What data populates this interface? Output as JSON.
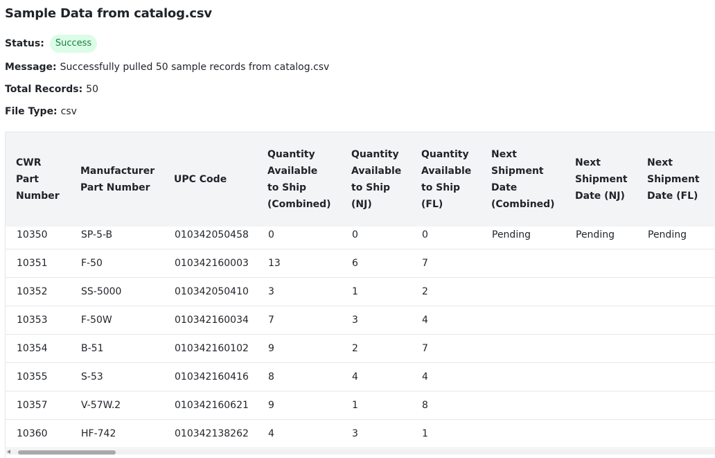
{
  "page": {
    "title": "Sample Data from catalog.csv",
    "status_label": "Status:",
    "status_value": "Success",
    "message_label": "Message:",
    "message_value": "Successfully pulled 50 sample records from catalog.csv",
    "total_label": "Total Records:",
    "total_value": "50",
    "filetype_label": "File Type:",
    "filetype_value": "csv"
  },
  "colors": {
    "badge_bg": "#dcfce7",
    "badge_text": "#15803d",
    "header_bg": "#f3f4f6"
  },
  "table": {
    "headers": [
      [
        "CWR",
        "Part",
        "Number"
      ],
      [
        "Manufacturer",
        "Part Number"
      ],
      [
        "UPC Code"
      ],
      [
        "Quantity",
        "Available",
        "to Ship",
        "(Combined)"
      ],
      [
        "Quantity",
        "Available",
        "to Ship",
        "(NJ)"
      ],
      [
        "Quantity",
        "Available",
        "to Ship",
        "(FL)"
      ],
      [
        "Next",
        "Shipment",
        "Date",
        "(Combined)"
      ],
      [
        "Next",
        "Shipment",
        "Date (NJ)"
      ],
      [
        "Next",
        "Shipment",
        "Date (FL)"
      ]
    ],
    "rows": [
      [
        "10350",
        "SP-5-B",
        "010342050458",
        "0",
        "0",
        "0",
        "Pending",
        "Pending",
        "Pending"
      ],
      [
        "10351",
        "F-50",
        "010342160003",
        "13",
        "6",
        "7",
        "",
        "",
        ""
      ],
      [
        "10352",
        "SS-5000",
        "010342050410",
        "3",
        "1",
        "2",
        "",
        "",
        ""
      ],
      [
        "10353",
        "F-50W",
        "010342160034",
        "7",
        "3",
        "4",
        "",
        "",
        ""
      ],
      [
        "10354",
        "B-51",
        "010342160102",
        "9",
        "2",
        "7",
        "",
        "",
        ""
      ],
      [
        "10355",
        "S-53",
        "010342160416",
        "8",
        "4",
        "4",
        "",
        "",
        ""
      ],
      [
        "10357",
        "V-57W.2",
        "010342160621",
        "9",
        "1",
        "8",
        "",
        "",
        ""
      ],
      [
        "10360",
        "HF-742",
        "010342138262",
        "4",
        "3",
        "1",
        "",
        "",
        ""
      ]
    ]
  }
}
